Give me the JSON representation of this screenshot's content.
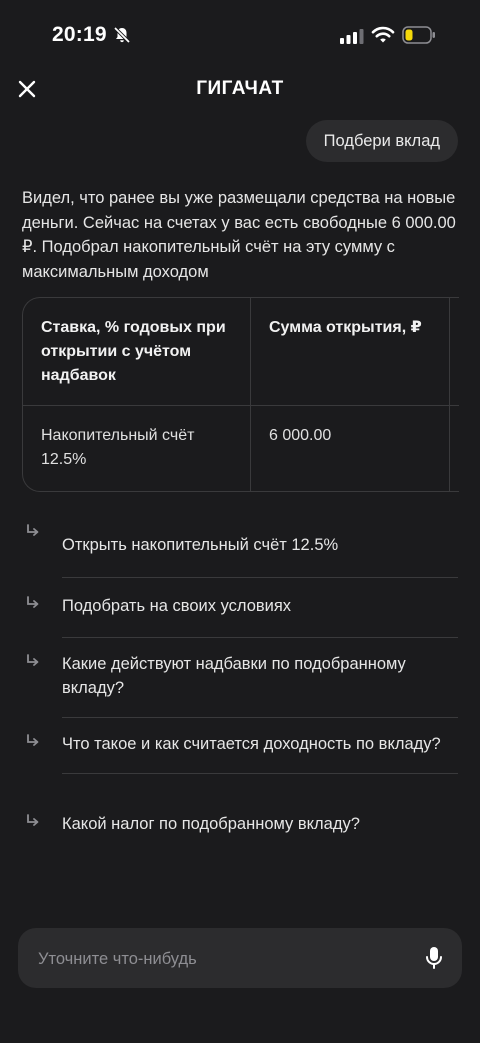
{
  "status": {
    "time": "20:19"
  },
  "header": {
    "logo": "ГИГАЧАТ"
  },
  "chat": {
    "user_message": "Подбери вклад",
    "answer": "Видел, что ранее вы уже размещали средства на новые деньги. Сейчас на счетах у вас есть свободные 6 000.00 ₽. Подобрал накопительный счёт на эту сумму с максимальным доходом"
  },
  "table": {
    "headers": [
      "Ставка, % годовых при открытии с учё­том надбавок",
      "Сумма открытия, ₽"
    ],
    "rows": [
      [
        "Накопительный счёт 12.5%",
        "6 000.00"
      ]
    ]
  },
  "suggestions": [
    "Открыть накопительный счёт 12.5%",
    "Подобрать на своих условиях",
    "Какие действуют надбавки по подобранному вкладу?",
    "Что такое и как считается доходность по вкладу?",
    "Какой налог по подобранному вкладу?"
  ],
  "input": {
    "placeholder": "Уточните что-нибудь"
  },
  "colors": {
    "background": "#1b1b1d",
    "surface": "#2c2c2e",
    "divider": "#3a3a3c",
    "battery": "#f5d90a"
  }
}
